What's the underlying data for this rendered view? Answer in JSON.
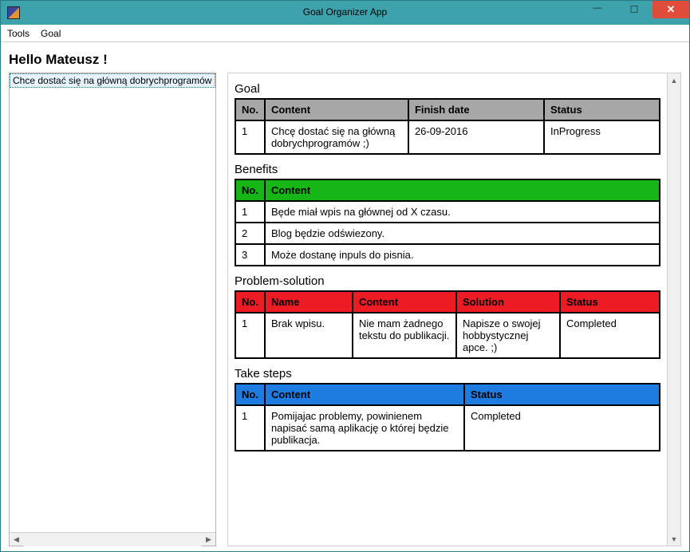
{
  "window": {
    "title": "Goal Organizer App"
  },
  "menu": {
    "items": [
      "Tools",
      "Goal"
    ]
  },
  "greeting": "Hello Mateusz !",
  "goals_list": {
    "items": [
      {
        "text": "Chce dostać się na główną dobrychprogramów",
        "selected": true
      }
    ]
  },
  "sections": {
    "goal": {
      "title": "Goal",
      "headers": [
        "No.",
        "Content",
        "Finish date",
        "Status"
      ],
      "rows": [
        {
          "no": "1",
          "content": "Chcę dostać się na główną dobrychprogramów ;)",
          "finish_date": "26-09-2016",
          "status": "InProgress"
        }
      ]
    },
    "benefits": {
      "title": "Benefits",
      "headers": [
        "No.",
        "Content"
      ],
      "rows": [
        {
          "no": "1",
          "content": "Będe miał wpis na głównej od X czasu."
        },
        {
          "no": "2",
          "content": "Blog będzie odświezony."
        },
        {
          "no": "3",
          "content": "Może dostanę inpuls do pisnia."
        }
      ]
    },
    "problem_solution": {
      "title": "Problem-solution",
      "headers": [
        "No.",
        "Name",
        "Content",
        "Solution",
        "Status"
      ],
      "rows": [
        {
          "no": "1",
          "name": "Brak wpisu.",
          "content": "Nie mam żadnego tekstu do publikacji.",
          "solution": "Napisze o swojej hobbystycznej apce. ;)",
          "status": "Completed"
        }
      ]
    },
    "take_steps": {
      "title": "Take steps",
      "headers": [
        "No.",
        "Content",
        "Status"
      ],
      "rows": [
        {
          "no": "1",
          "content": "Pomijajac problemy, powinienem napisać samą aplikację o której będzie publikacja.",
          "status": "Completed"
        }
      ]
    }
  }
}
